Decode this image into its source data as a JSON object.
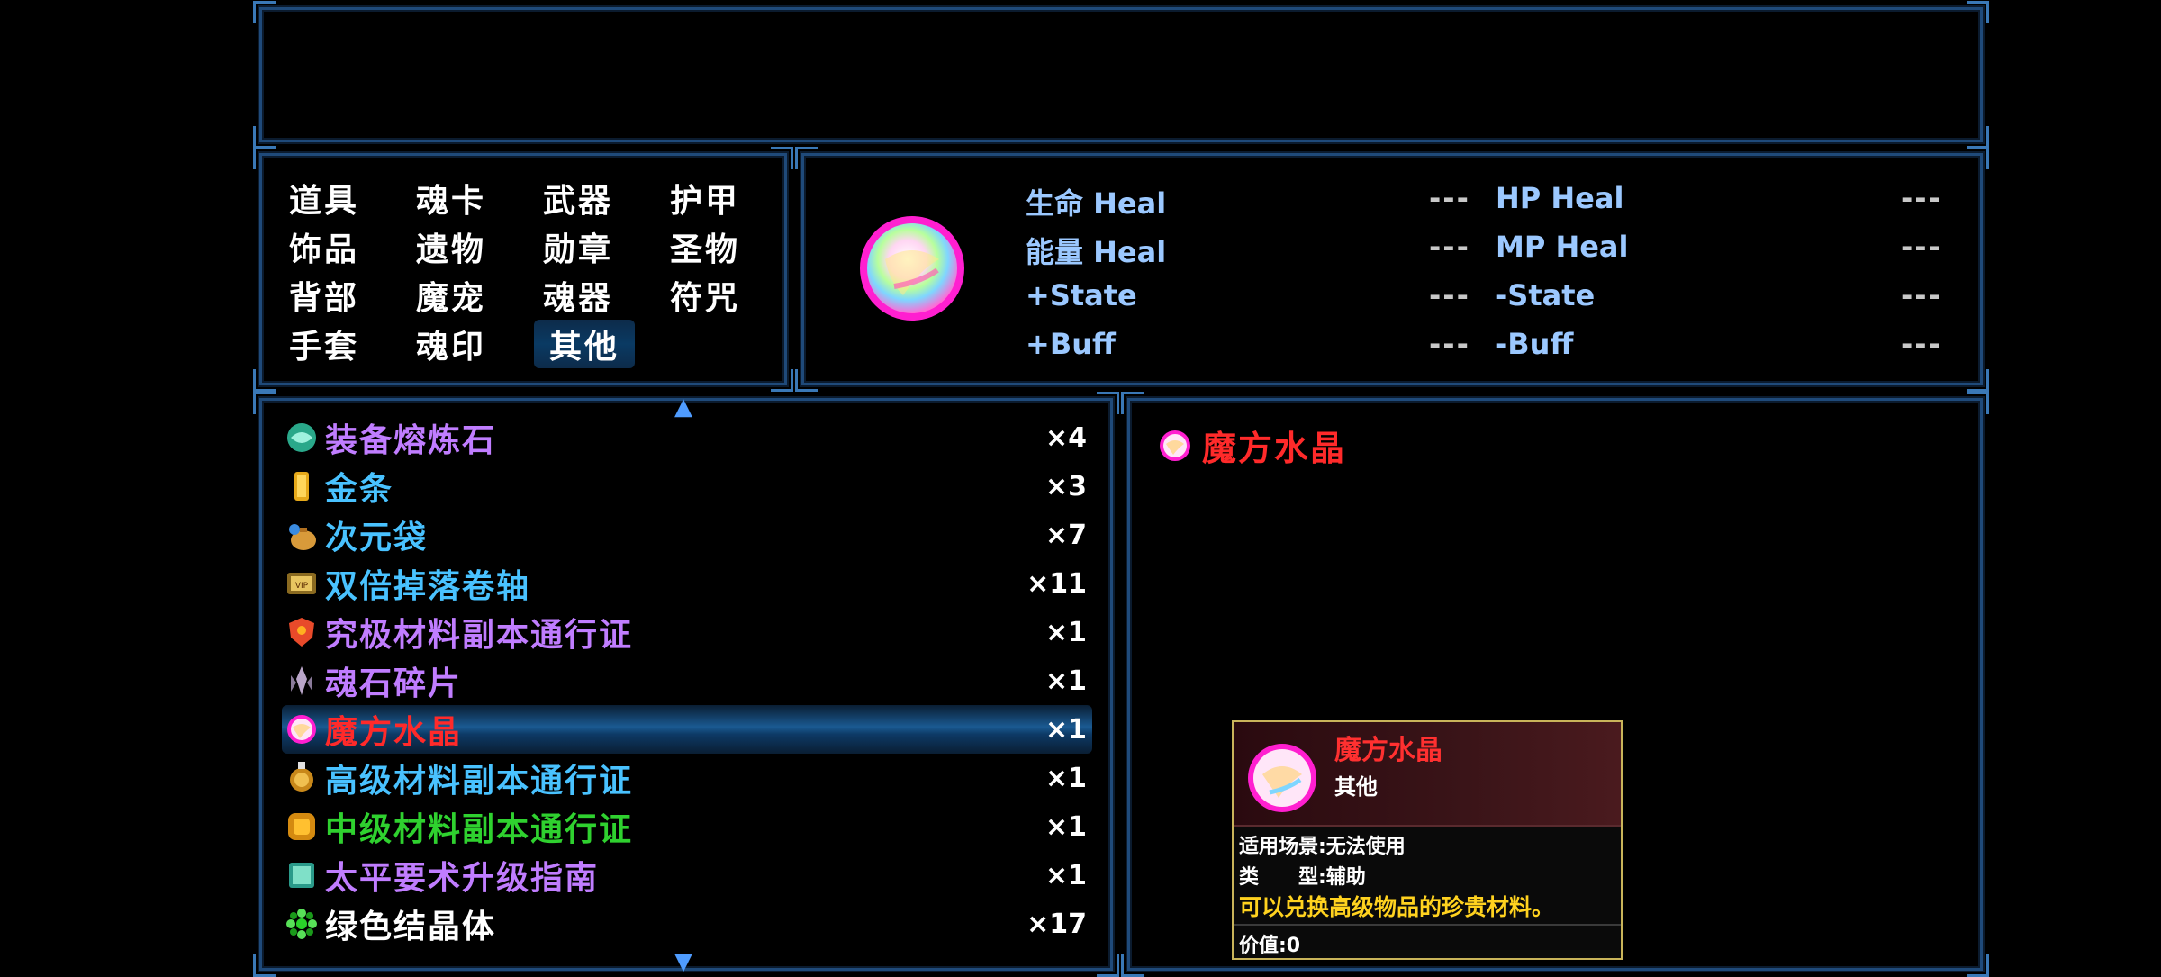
{
  "categories": [
    "道具",
    "魂卡",
    "武器",
    "护甲",
    "饰品",
    "遗物",
    "勋章",
    "圣物",
    "背部",
    "魔宠",
    "魂器",
    "符咒",
    "手套",
    "魂印",
    "其他"
  ],
  "active_category": "其他",
  "stats": {
    "hp_heal_cn": "生命 Heal",
    "mp_heal_cn": "能量 Heal",
    "add_state": "+State",
    "add_buff": "+Buff",
    "hp_heal": "HP Heal",
    "mp_heal": "MP Heal",
    "sub_state": "-State",
    "sub_buff": "-Buff",
    "dash": "---"
  },
  "items": [
    {
      "name": "装备熔炼石",
      "qty": "×4",
      "color": "#c07dff",
      "icon": "green-orb-icon"
    },
    {
      "name": "金条",
      "qty": "×3",
      "color": "#49c2ff",
      "icon": "gold-bar-icon"
    },
    {
      "name": "次元袋",
      "qty": "×7",
      "color": "#49c2ff",
      "icon": "bag-icon"
    },
    {
      "name": "双倍掉落卷轴",
      "qty": "×11",
      "color": "#49c2ff",
      "icon": "scroll-icon"
    },
    {
      "name": "究极材料副本通行证",
      "qty": "×1",
      "color": "#c07dff",
      "icon": "shield-badge-icon"
    },
    {
      "name": "魂石碎片",
      "qty": "×1",
      "color": "#c07dff",
      "icon": "crystal-shard-icon"
    },
    {
      "name": "魔方水晶",
      "qty": "×1",
      "color": "#ff2a2a",
      "icon": "rainbow-gem-icon"
    },
    {
      "name": "高级材料副本通行证",
      "qty": "×1",
      "color": "#49c2ff",
      "icon": "medal-icon"
    },
    {
      "name": "中级材料副本通行证",
      "qty": "×1",
      "color": "#2fd12f",
      "icon": "coin-icon"
    },
    {
      "name": "太平要术升级指南",
      "qty": "×1",
      "color": "#c07dff",
      "icon": "book-icon"
    },
    {
      "name": "绿色结晶体",
      "qty": "×17",
      "color": "#ffffff",
      "icon": "green-crystal-icon"
    }
  ],
  "selected_index": 6,
  "detail": {
    "name": "魔方水晶"
  },
  "tooltip": {
    "name": "魔方水晶",
    "type": "其他",
    "usage": "适用场景:无法使用",
    "category": "类　　型:辅助",
    "description": "可以兑换高级物品的珍贵材料。",
    "value": "价值:0"
  }
}
